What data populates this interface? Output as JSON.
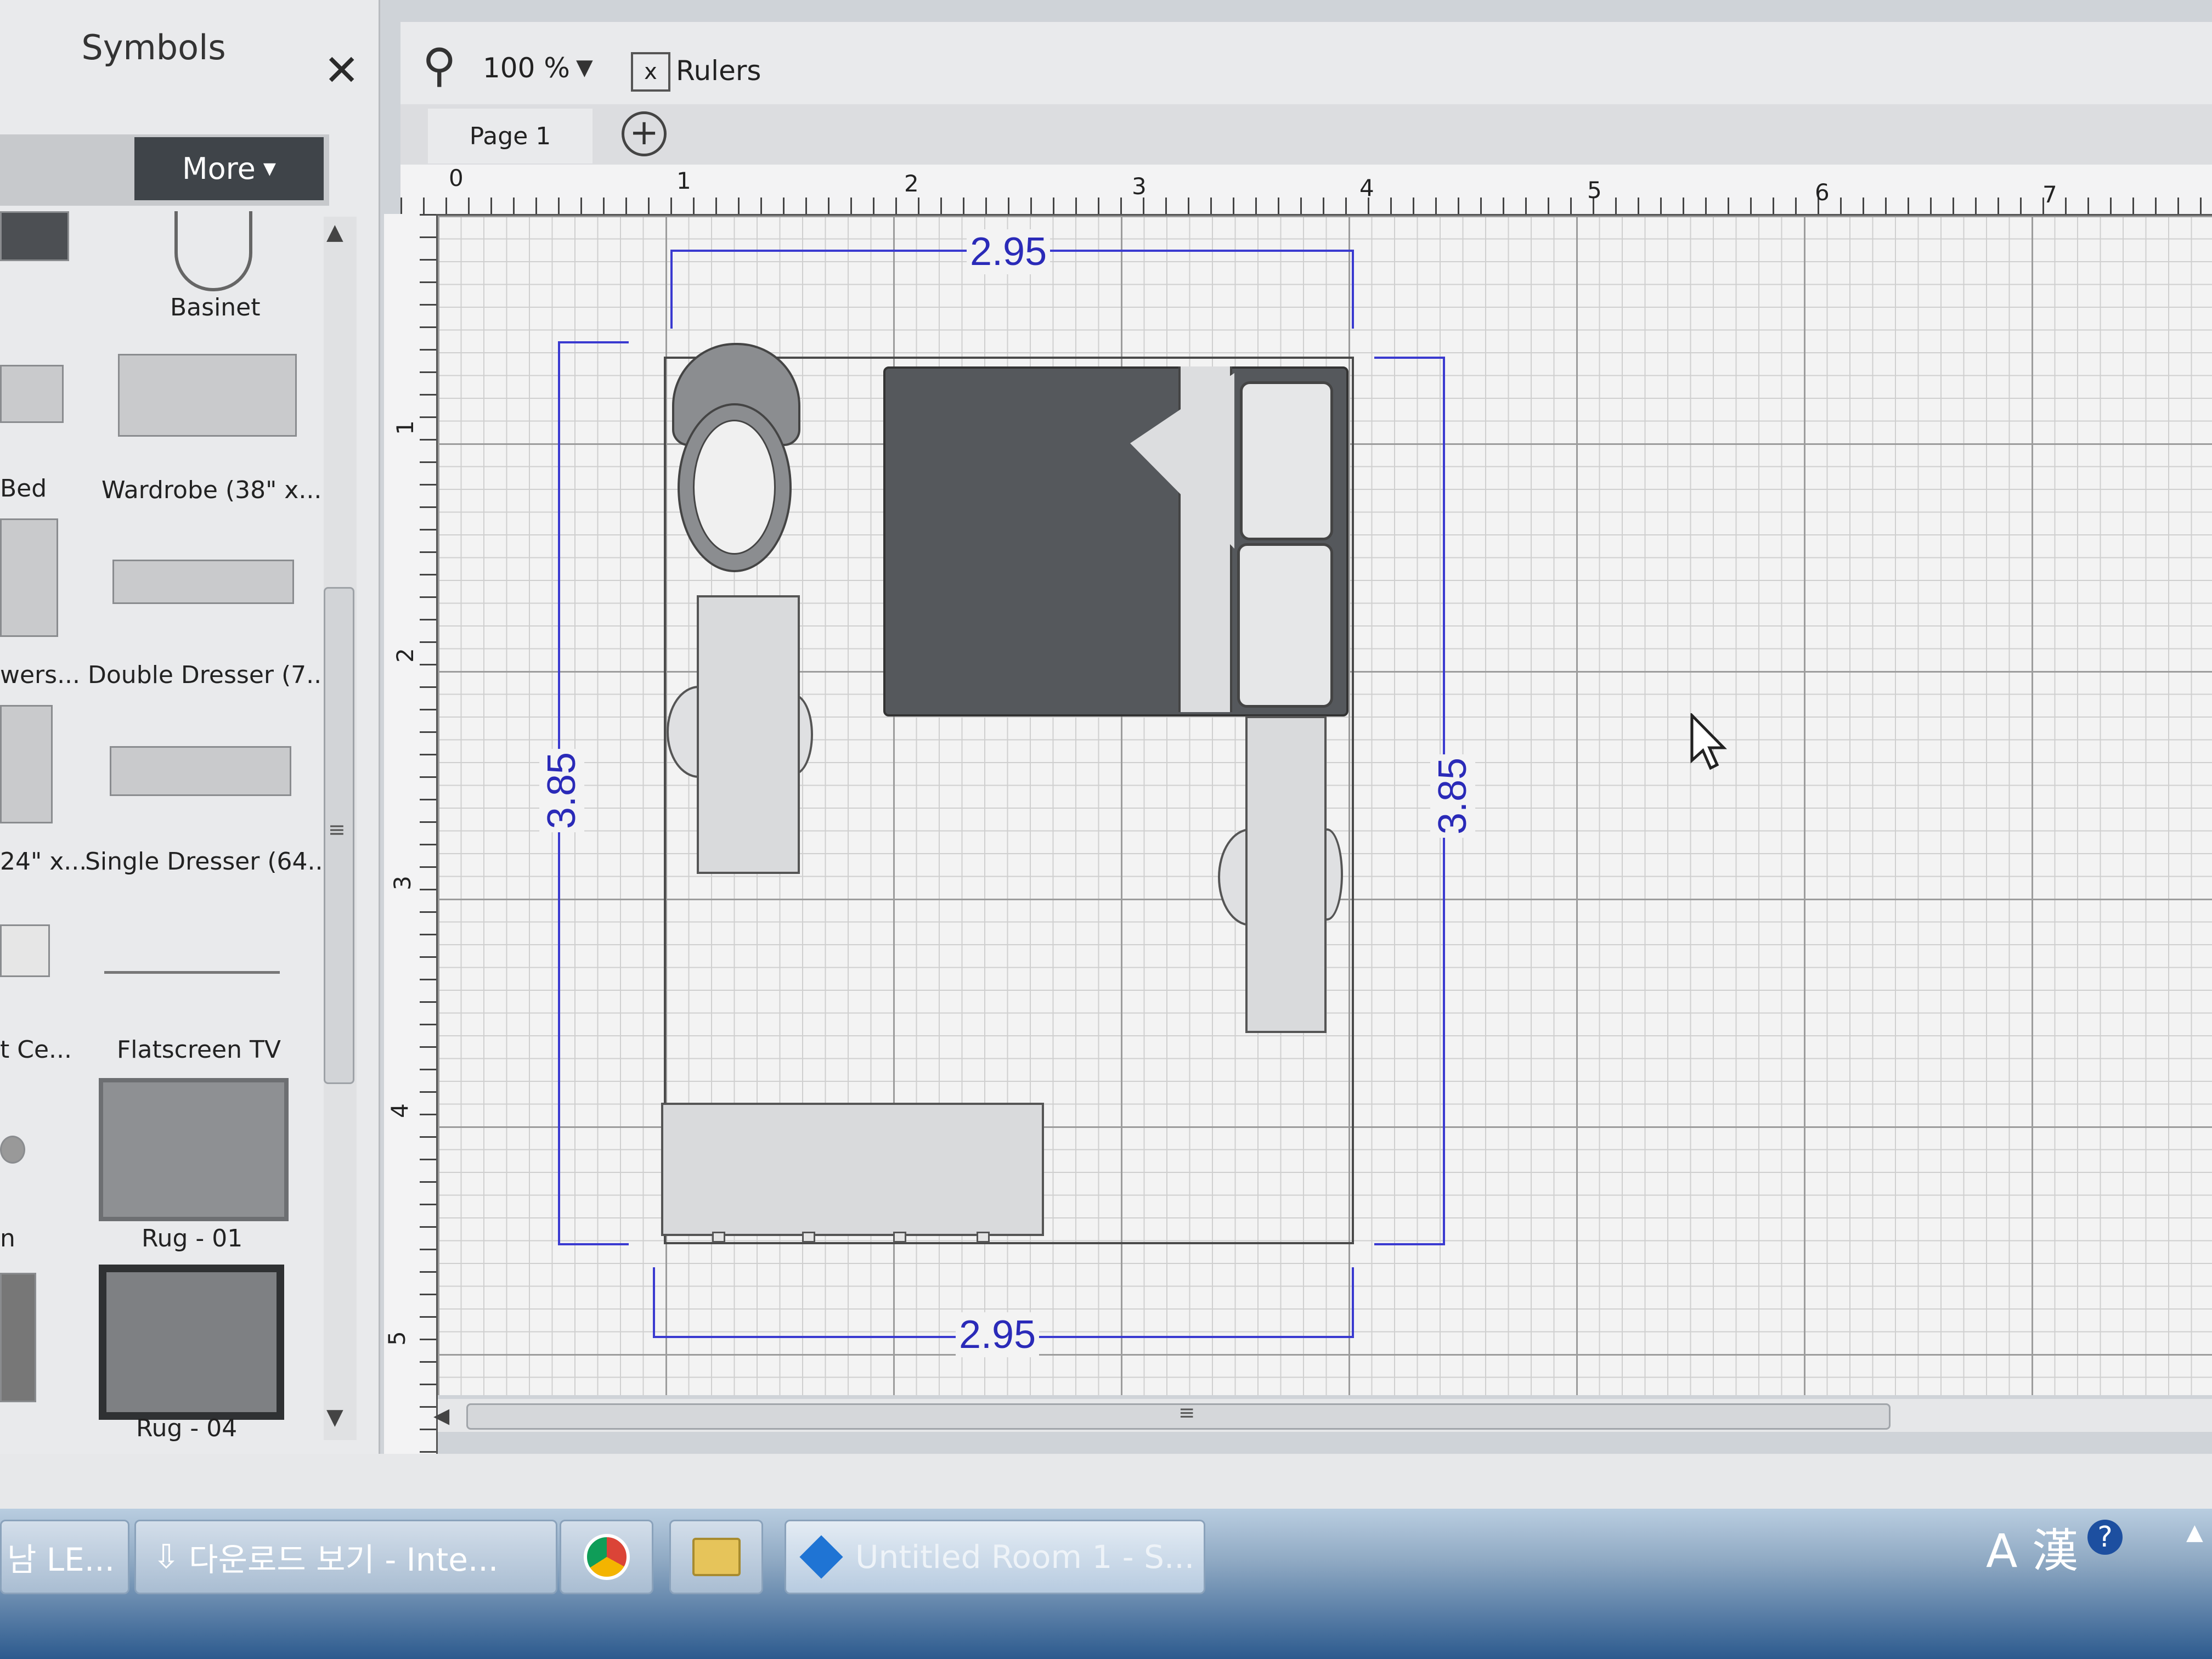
{
  "panel": {
    "title": "Symbols",
    "close_label": "✕",
    "more_label": "More",
    "scroll_up": "▲",
    "scroll_down": "▼",
    "scroll_grip": "≡",
    "symbols": [
      {
        "label": "Basinet"
      },
      {
        "label": "Bed"
      },
      {
        "label": "Wardrobe (38\" x..."
      },
      {
        "label": "wers..."
      },
      {
        "label": "Double Dresser (7..."
      },
      {
        "label": "24\" x..."
      },
      {
        "label": "Single Dresser (64..."
      },
      {
        "label": "t Ce..."
      },
      {
        "label": "Flatscreen TV"
      },
      {
        "label": "n"
      },
      {
        "label": "Rug - 01"
      },
      {
        "label": "Rug - 04"
      }
    ]
  },
  "toolbar": {
    "zoom_icon": "⚲",
    "zoom_value": "100 %",
    "zoom_dropdown": "▼",
    "rulers_icon": "x",
    "rulers_label": "Rulers"
  },
  "tabs": {
    "page_label": "Page 1",
    "add_label": "+"
  },
  "ruler": {
    "top": [
      "0",
      "1",
      "2",
      "3",
      "4",
      "5",
      "6",
      "7"
    ],
    "left": [
      "1",
      "2",
      "3",
      "4",
      "5"
    ]
  },
  "plan": {
    "width_top": "2.95",
    "width_bottom": "2.95",
    "height_left": "3.85",
    "height_right": "3.85"
  },
  "scrollbar": {
    "left_arrow": "◀",
    "grip": "≡"
  },
  "taskbar": {
    "items": [
      {
        "label": "남 LE..."
      },
      {
        "label": "다운로드 보기 - Inte..."
      },
      {
        "label": "Untitled Room 1 - S..."
      }
    ],
    "ime": "A 漢",
    "help": "?",
    "expand": "▲"
  },
  "colors": {
    "dimension": "#3a3ad0",
    "bed": "#55585c",
    "more_button": "#3f4449"
  }
}
